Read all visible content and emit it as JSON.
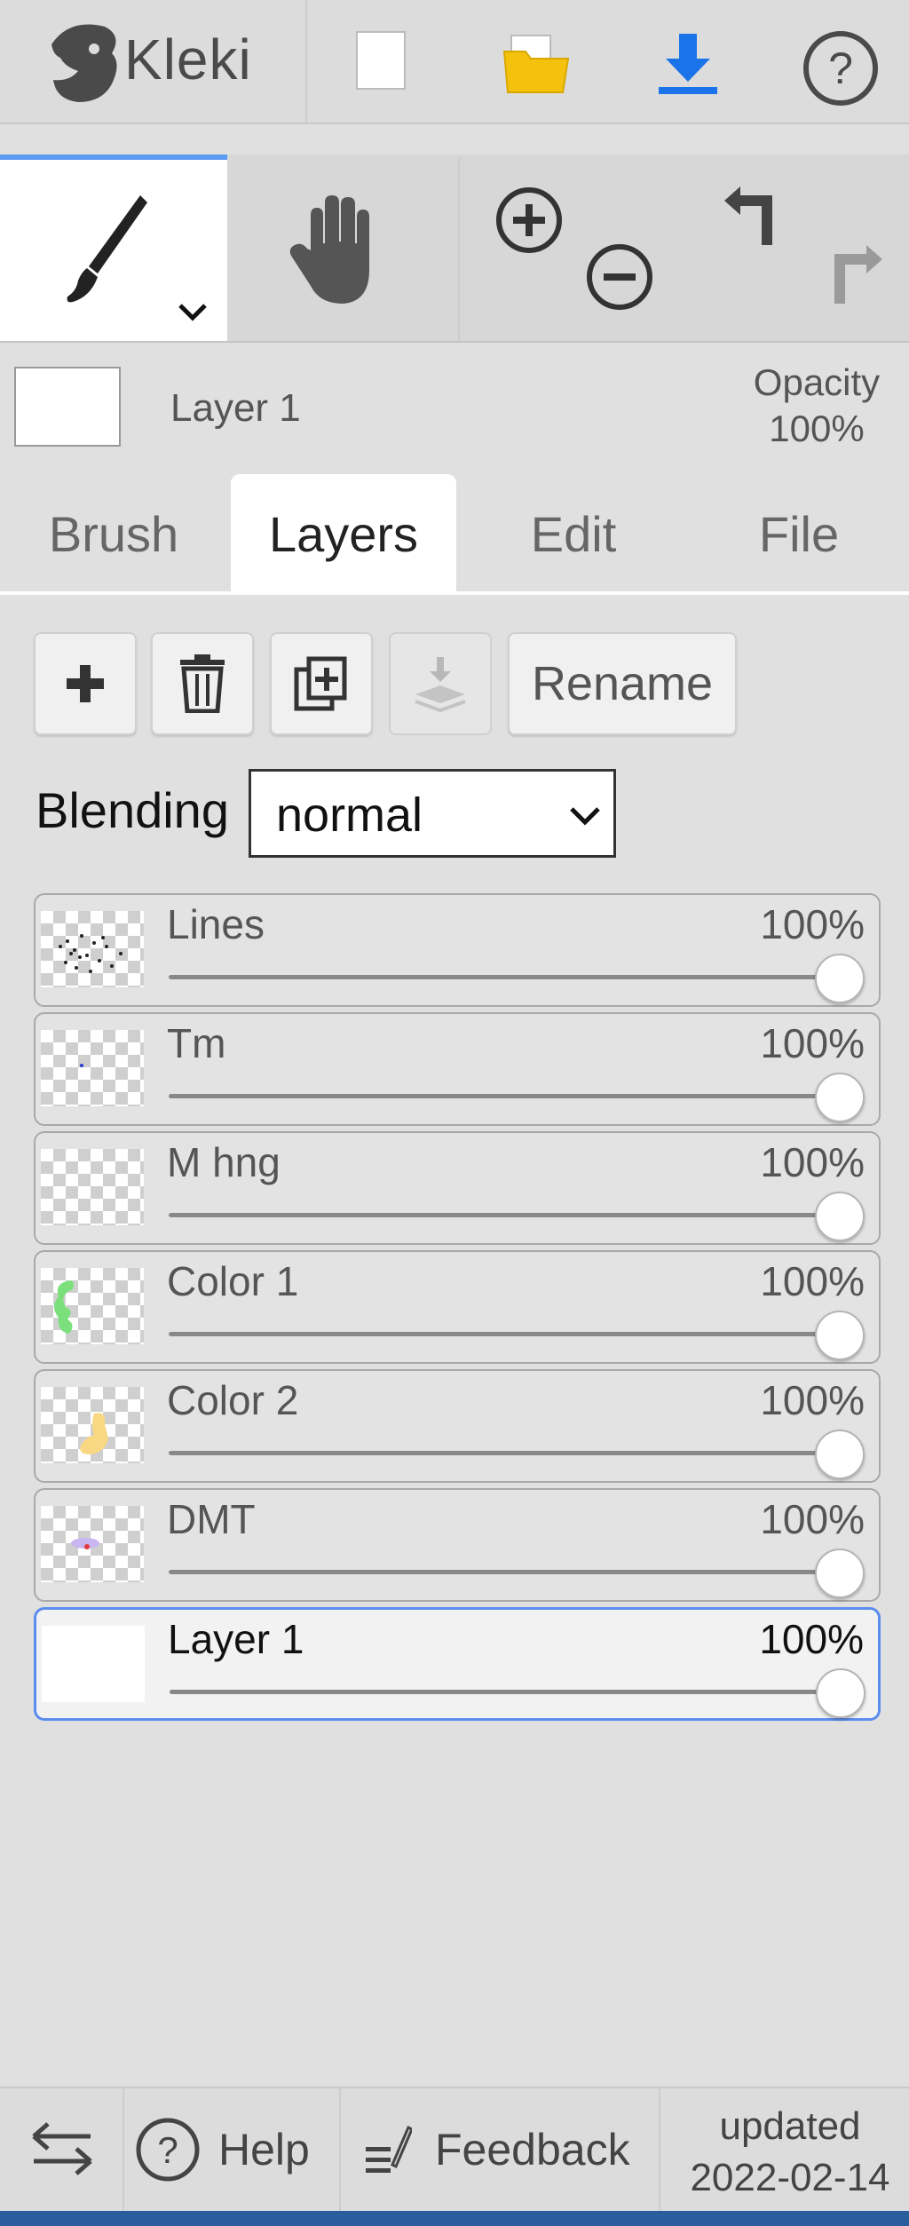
{
  "app": {
    "name": "Kleki"
  },
  "colors": {
    "accent": "#5b9bf2",
    "download": "#1a73e8",
    "folder": "#f4c20d"
  },
  "toolbar": {
    "logo_icon": "kleki-logo-icon",
    "actions": [
      "new-image-icon",
      "open-folder-icon",
      "download-icon",
      "help-icon"
    ]
  },
  "tools": {
    "brush": "brush-icon",
    "hand": "hand-icon",
    "zoom_in": "zoom-in-icon",
    "zoom_out": "zoom-out-icon",
    "undo": "undo-icon",
    "redo": "redo-icon"
  },
  "layer_info": {
    "name": "Layer 1",
    "opacity_label": "Opacity",
    "opacity_value": "100%"
  },
  "tabs": [
    {
      "label": "Brush"
    },
    {
      "label": "Layers"
    },
    {
      "label": "Edit"
    },
    {
      "label": "File"
    }
  ],
  "layer_actions": {
    "add": "plus-icon",
    "delete": "trash-icon",
    "duplicate": "duplicate-icon",
    "merge": "merge-down-icon",
    "rename_label": "Rename"
  },
  "blending": {
    "label": "Blending",
    "value": "normal"
  },
  "layers": [
    {
      "name": "Lines",
      "opacity": "100%",
      "opacity_fraction": 1.0
    },
    {
      "name": "Tm",
      "opacity": "100%",
      "opacity_fraction": 1.0
    },
    {
      "name": "M hng",
      "opacity": "100%",
      "opacity_fraction": 1.0
    },
    {
      "name": "Color 1",
      "opacity": "100%",
      "opacity_fraction": 1.0
    },
    {
      "name": "Color 2",
      "opacity": "100%",
      "opacity_fraction": 1.0
    },
    {
      "name": "DMT",
      "opacity": "100%",
      "opacity_fraction": 1.0
    },
    {
      "name": "Layer 1",
      "opacity": "100%",
      "opacity_fraction": 1.0,
      "selected": true
    }
  ],
  "footer": {
    "swap_icon": "swap-icon",
    "help_label": "Help",
    "feedback_label": "Feedback",
    "updated_label": "updated",
    "updated_date": "2022-02-14"
  }
}
